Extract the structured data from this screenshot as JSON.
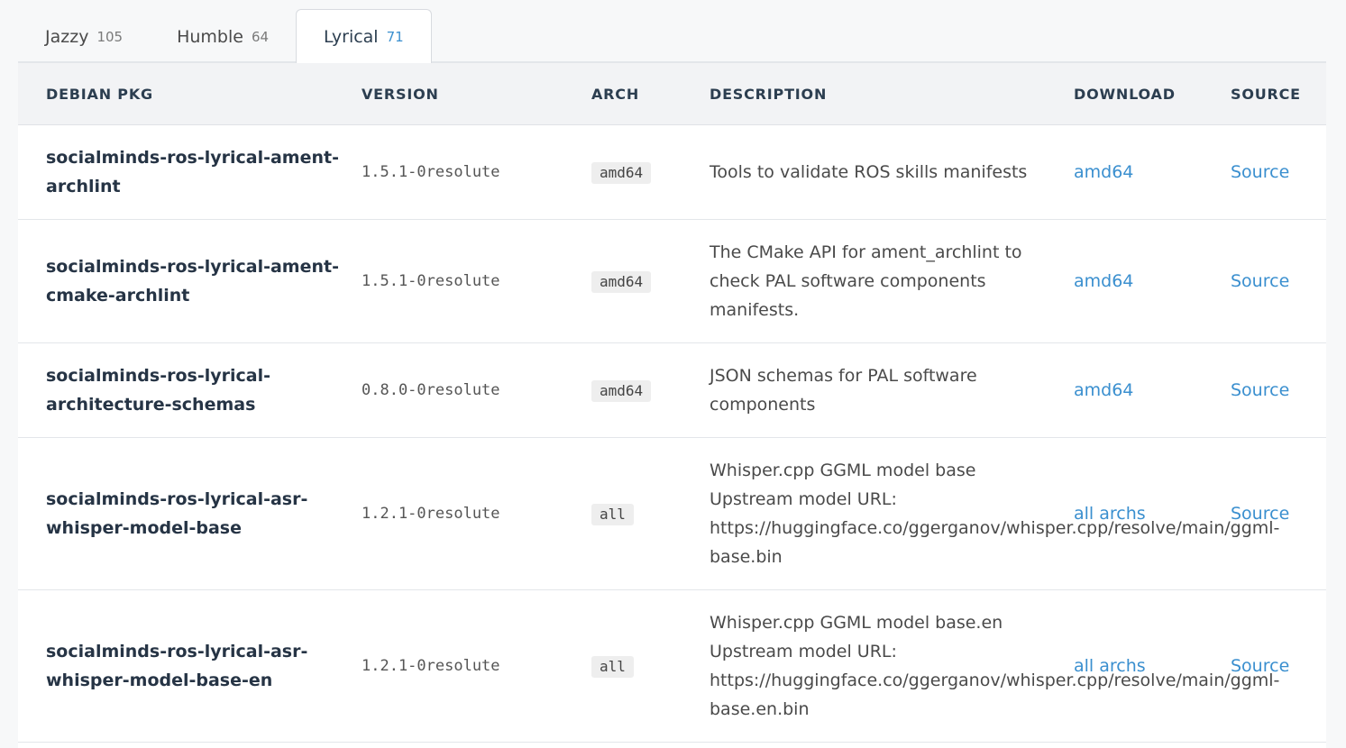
{
  "tabs": [
    {
      "label": "Jazzy",
      "count": "105",
      "active": false
    },
    {
      "label": "Humble",
      "count": "64",
      "active": false
    },
    {
      "label": "Lyrical",
      "count": "71",
      "active": true
    }
  ],
  "columns": [
    "DEBIAN PKG",
    "VERSION",
    "ARCH",
    "DESCRIPTION",
    "DOWNLOAD",
    "SOURCE"
  ],
  "rows": [
    {
      "pkg": "socialminds-ros-lyrical-ament-archlint",
      "version": "1.5.1-0resolute",
      "arch": "amd64",
      "description": "Tools to validate ROS skills manifests",
      "download": "amd64",
      "source": "Source"
    },
    {
      "pkg": "socialminds-ros-lyrical-ament-cmake-archlint",
      "version": "1.5.1-0resolute",
      "arch": "amd64",
      "description": "The CMake API for ament_archlint to check PAL software components manifests.",
      "download": "amd64",
      "source": "Source"
    },
    {
      "pkg": "socialminds-ros-lyrical-architecture-schemas",
      "version": "0.8.0-0resolute",
      "arch": "amd64",
      "description": "JSON schemas for PAL software components",
      "download": "amd64",
      "source": "Source"
    },
    {
      "pkg": "socialminds-ros-lyrical-asr-whisper-model-base",
      "version": "1.2.1-0resolute",
      "arch": "all",
      "description": "Whisper.cpp GGML model base Upstream model URL: https://huggingface.co/ggerganov/whisper.cpp/resolve/main/ggml-base.bin",
      "download": "all archs",
      "source": "Source"
    },
    {
      "pkg": "socialminds-ros-lyrical-asr-whisper-model-base-en",
      "version": "1.2.1-0resolute",
      "arch": "all",
      "description": "Whisper.cpp GGML model base.en Upstream model URL: https://huggingface.co/ggerganov/whisper.cpp/resolve/main/ggml-base.en.bin",
      "download": "all archs",
      "source": "Source"
    }
  ],
  "colors": {
    "link": "#3a8fcf",
    "header_bg": "#f2f3f5",
    "heading_text": "#2c3e50"
  }
}
